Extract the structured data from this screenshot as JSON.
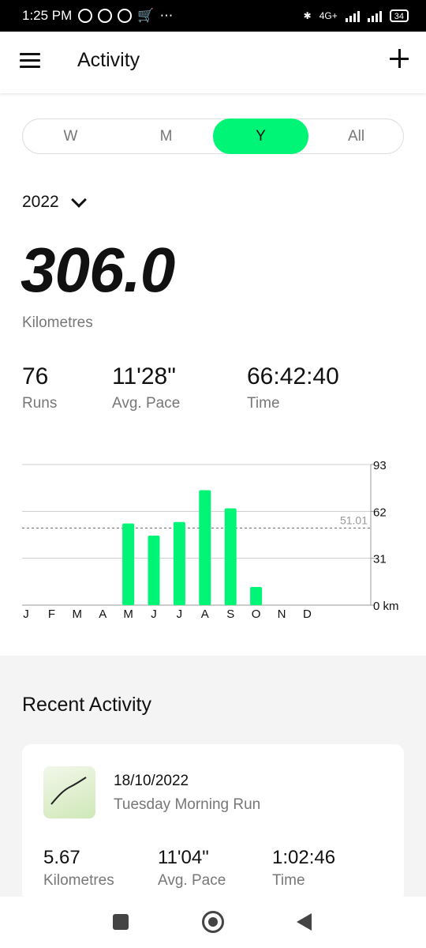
{
  "status": {
    "time": "1:25 PM",
    "network": "4G+",
    "battery": "34"
  },
  "header": {
    "title": "Activity"
  },
  "tabs": [
    {
      "label": "W",
      "active": false
    },
    {
      "label": "M",
      "active": false
    },
    {
      "label": "Y",
      "active": true
    },
    {
      "label": "All",
      "active": false
    }
  ],
  "year": "2022",
  "summary": {
    "distance": "306.0",
    "distance_unit": "Kilometres",
    "runs": "76",
    "runs_label": "Runs",
    "pace": "11'28\"",
    "pace_label": "Avg. Pace",
    "time": "66:42:40",
    "time_label": "Time"
  },
  "accent": "#00F576",
  "chart_data": {
    "type": "bar",
    "categories": [
      "J",
      "F",
      "M",
      "A",
      "M",
      "J",
      "J",
      "A",
      "S",
      "O",
      "N",
      "D"
    ],
    "values": [
      0,
      0,
      0,
      0,
      54,
      46,
      55,
      76,
      64,
      12,
      0,
      0
    ],
    "ylim": [
      0,
      93
    ],
    "y_ticks": [
      "93",
      "62",
      "31",
      "0 km"
    ],
    "average": 51.01,
    "average_label": "51.01",
    "grid": true,
    "color": "#00F576"
  },
  "recent": {
    "title": "Recent Activity",
    "items": [
      {
        "date": "18/10/2022",
        "name": "Tuesday Morning Run",
        "distance": "5.67",
        "distance_label": "Kilometres",
        "pace": "11'04\"",
        "pace_label": "Avg. Pace",
        "time": "1:02:46",
        "time_label": "Time"
      }
    ]
  },
  "icons": {
    "menu": "hamburger-menu-icon",
    "add": "plus-icon",
    "dropdown": "chevron-down-icon",
    "route": "route-thumbnail"
  }
}
